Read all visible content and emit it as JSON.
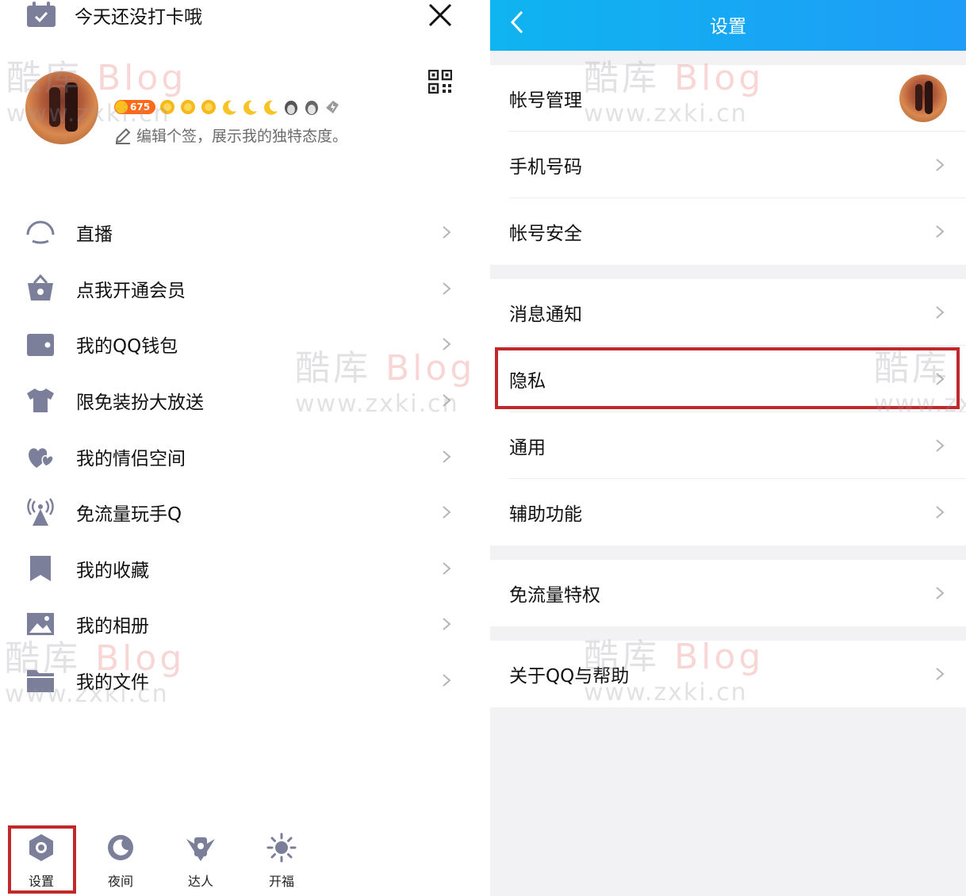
{
  "left": {
    "checkin_text": "今天还没打卡哦",
    "level_badge": "675",
    "signature_placeholder": "编辑个签，展示我的独特态度。",
    "menu": [
      {
        "label": "直播",
        "icon": "live-icon"
      },
      {
        "label": "点我开通会员",
        "icon": "vip-basket-icon"
      },
      {
        "label": "我的QQ钱包",
        "icon": "wallet-icon"
      },
      {
        "label": "限免装扮大放送",
        "icon": "tshirt-icon"
      },
      {
        "label": "我的情侣空间",
        "icon": "hearts-icon"
      },
      {
        "label": "免流量玩手Q",
        "icon": "antenna-icon"
      },
      {
        "label": "我的收藏",
        "icon": "bookmark-icon"
      },
      {
        "label": "我的相册",
        "icon": "photo-icon"
      },
      {
        "label": "我的文件",
        "icon": "folder-icon"
      }
    ],
    "tabbar": [
      {
        "label": "设置",
        "icon": "settings-hex-icon"
      },
      {
        "label": "夜间",
        "icon": "moon-icon"
      },
      {
        "label": "达人",
        "icon": "winged-badge-icon"
      },
      {
        "label": "开福",
        "icon": "sun-icon"
      }
    ]
  },
  "right": {
    "title": "设置",
    "groups": [
      [
        "帐号管理",
        "手机号码",
        "帐号安全"
      ],
      [
        "消息通知",
        "隐私",
        "通用",
        "辅助功能"
      ],
      [
        "免流量特权"
      ],
      [
        "关于QQ与帮助"
      ]
    ]
  },
  "watermark": {
    "cn": "酷库",
    "en": "Blog",
    "url": "www.zxki.cn"
  },
  "colors": {
    "header_gradient_start": "#0fb4f0",
    "header_gradient_end": "#1e9cf7",
    "highlight_border": "#c0282a",
    "icon_gray": "#7b7f99",
    "level_orange": "#ff6a1a"
  }
}
